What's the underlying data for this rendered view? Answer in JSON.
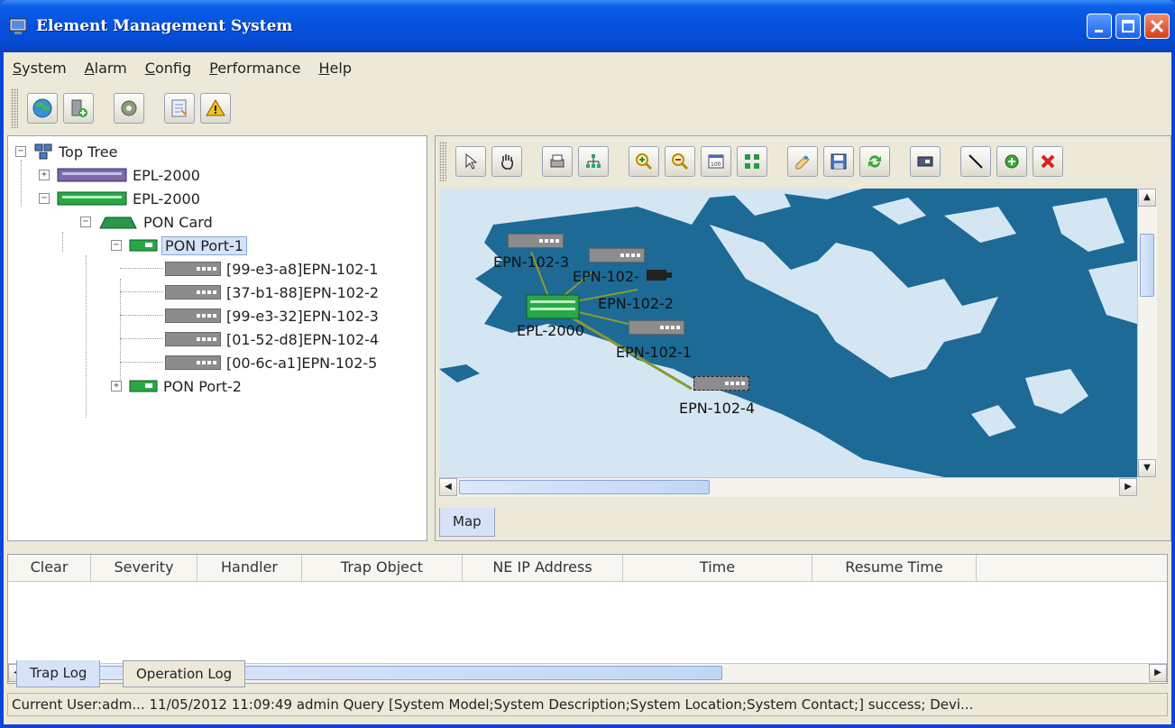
{
  "window": {
    "title": "Element Management System"
  },
  "menu": {
    "items": [
      {
        "label": "System",
        "mnemonic": "S",
        "rest": "ystem"
      },
      {
        "label": "Alarm",
        "mnemonic": "A",
        "rest": "larm"
      },
      {
        "label": "Config",
        "mnemonic": "C",
        "rest": "onfig"
      },
      {
        "label": "Performance",
        "mnemonic": "P",
        "rest": "erformance"
      },
      {
        "label": "Help",
        "mnemonic": "H",
        "rest": "elp"
      }
    ]
  },
  "toolbar": {
    "icons": [
      "topology-globe-icon",
      "add-device-icon",
      "settings-gear-icon",
      "report-icon",
      "alarm-warning-icon"
    ]
  },
  "tree": {
    "root": "Top Tree",
    "olt1": "EPL-2000",
    "olt2": "EPL-2000",
    "pon_card": "PON Card",
    "pon_port1": "PON Port-1",
    "onus": [
      "[99-e3-a8]EPN-102-1",
      "[37-b1-88]EPN-102-2",
      "[99-e3-32]EPN-102-3",
      "[01-52-d8]EPN-102-4",
      "[00-6c-a1]EPN-102-5"
    ],
    "pon_port2": "PON Port-2"
  },
  "map": {
    "tab_label": "Map",
    "nodes": {
      "olt": "EPL-2000",
      "onu1": "EPN-102-1",
      "onu2": "EPN-102-2",
      "onu3": "EPN-102-3",
      "onu4": "EPN-102-4",
      "onu2b": "EPN-102-"
    },
    "colors": {
      "land": "#1d6a96",
      "water": "#d5e6f3",
      "link": "#8a9a30"
    }
  },
  "alarm_table": {
    "columns": [
      "Clear",
      "Severity",
      "Handler",
      "Trap Object",
      "NE IP Address",
      "Time",
      "Resume Time"
    ],
    "tabs": [
      "Trap Log",
      "Operation Log"
    ]
  },
  "status_bar": {
    "text": "Current User:adm...      11/05/2012 11:09:49  admin  Query [System Model;System Description;System Location;System Contact;] success; Devi..."
  }
}
